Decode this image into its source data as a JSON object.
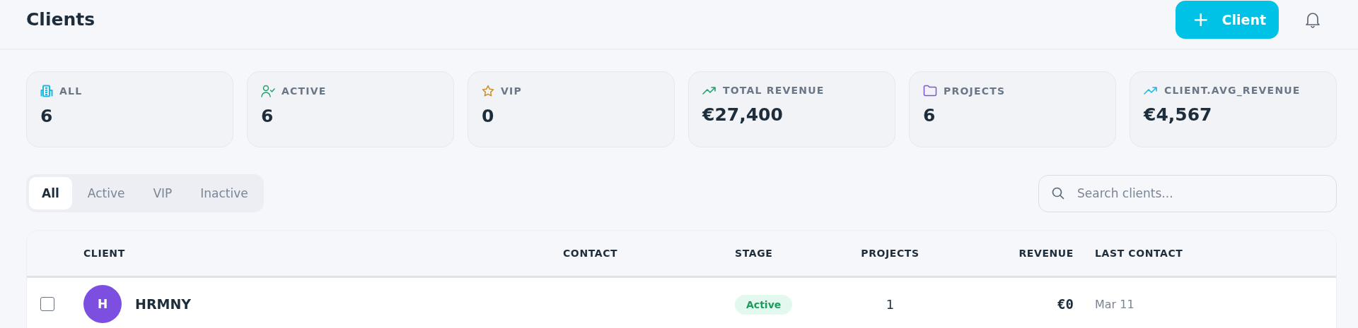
{
  "header": {
    "title": "Clients",
    "add_button": {
      "icon": "+",
      "label": "Client"
    }
  },
  "stats": [
    {
      "kind": "building",
      "color": "#1fb8de",
      "label": "ALL",
      "value": "6"
    },
    {
      "kind": "user-check",
      "color": "#22a06b",
      "label": "ACTIVE",
      "value": "6"
    },
    {
      "kind": "star",
      "color": "#c9902a",
      "label": "VIP",
      "value": "0"
    },
    {
      "kind": "trend",
      "color": "#22a06b",
      "label": "TOTAL REVENUE",
      "value": "€27,400"
    },
    {
      "kind": "folder",
      "color": "#7d55d6",
      "label": "PROJECTS",
      "value": "6"
    },
    {
      "kind": "trend",
      "color": "#1fb8de",
      "label": "CLIENT.AVG_REVENUE",
      "value": "€4,567"
    }
  ],
  "tabs": [
    {
      "label": "All",
      "selected": true
    },
    {
      "label": "Active",
      "selected": false
    },
    {
      "label": "VIP",
      "selected": false
    },
    {
      "label": "Inactive",
      "selected": false
    }
  ],
  "search": {
    "placeholder": "Search clients..."
  },
  "table": {
    "columns": [
      "CLIENT",
      "CONTACT",
      "STAGE",
      "PROJECTS",
      "REVENUE",
      "LAST CONTACT"
    ],
    "rows": [
      {
        "checked": false,
        "initial": "H",
        "color": "#7c4fe0",
        "name": "HRMNY",
        "stage": "Active",
        "projects": "1",
        "revenue": "€0",
        "last_contact": "Mar 11"
      }
    ]
  }
}
